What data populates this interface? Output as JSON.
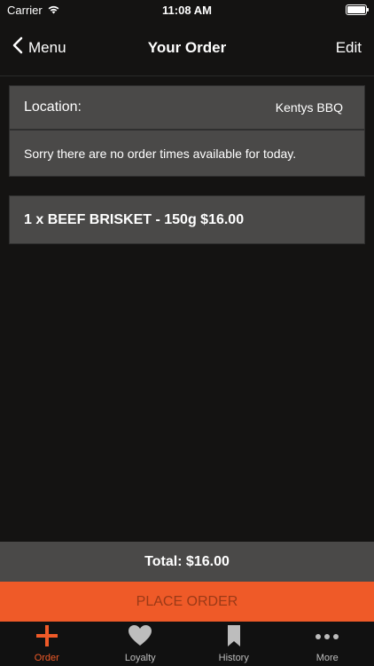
{
  "status_bar": {
    "carrier": "Carrier",
    "time": "11:08 AM"
  },
  "nav": {
    "back_label": "Menu",
    "title": "Your Order",
    "edit_label": "Edit"
  },
  "order": {
    "location_label": "Location:",
    "location_value": "Kentys BBQ",
    "message": "Sorry there are no order times available for today.",
    "items": [
      {
        "text": "1 x BEEF BRISKET - 150g $16.00"
      }
    ]
  },
  "total_label": "Total: $16.00",
  "place_order_label": "PLACE ORDER",
  "tabs": [
    {
      "label": "Order",
      "icon": "plus-icon",
      "active": true
    },
    {
      "label": "Loyalty",
      "icon": "heart-icon",
      "active": false
    },
    {
      "label": "History",
      "icon": "bookmark-icon",
      "active": false
    },
    {
      "label": "More",
      "icon": "more-dots-icon",
      "active": false
    }
  ],
  "colors": {
    "accent": "#ef5a28",
    "background": "#141312",
    "card": "#4a4948"
  }
}
